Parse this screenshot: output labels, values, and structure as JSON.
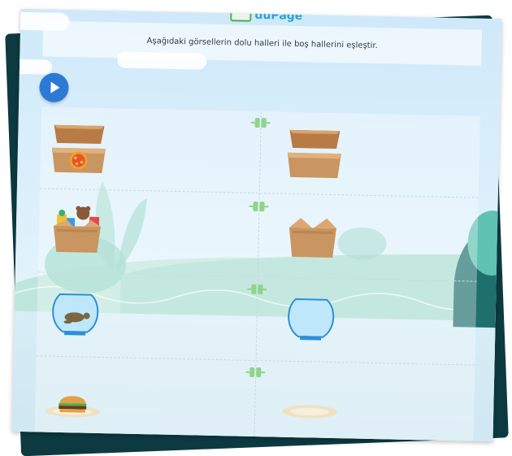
{
  "app": {
    "logo_text": "duPage"
  },
  "activity": {
    "instruction": "Aşağıdaki görsellerin dolu halleri ile boş hallerini eşleştir."
  },
  "controls": {
    "play_icon": "play-icon"
  },
  "left_items": [
    {
      "name": "pizza-box-full",
      "icon": "open-pizza-box-with-pizza"
    },
    {
      "name": "toy-box-full",
      "icon": "open-cardboard-box-with-toys"
    },
    {
      "name": "fishbowl-with-turtle",
      "icon": "fishbowl-with-turtle"
    },
    {
      "name": "plate-with-burger",
      "icon": "plate-with-hamburger"
    }
  ],
  "right_items": [
    {
      "name": "pizza-box-empty",
      "icon": "open-empty-pizza-box"
    },
    {
      "name": "cardboard-box-empty",
      "icon": "open-empty-cardboard-box"
    },
    {
      "name": "fishbowl-empty",
      "icon": "fishbowl-with-water"
    },
    {
      "name": "plate-empty",
      "icon": "empty-plate"
    }
  ],
  "colors": {
    "play_button": "#2c7ad6",
    "connector": "#8fd48a",
    "cardboard": "#c99560"
  }
}
